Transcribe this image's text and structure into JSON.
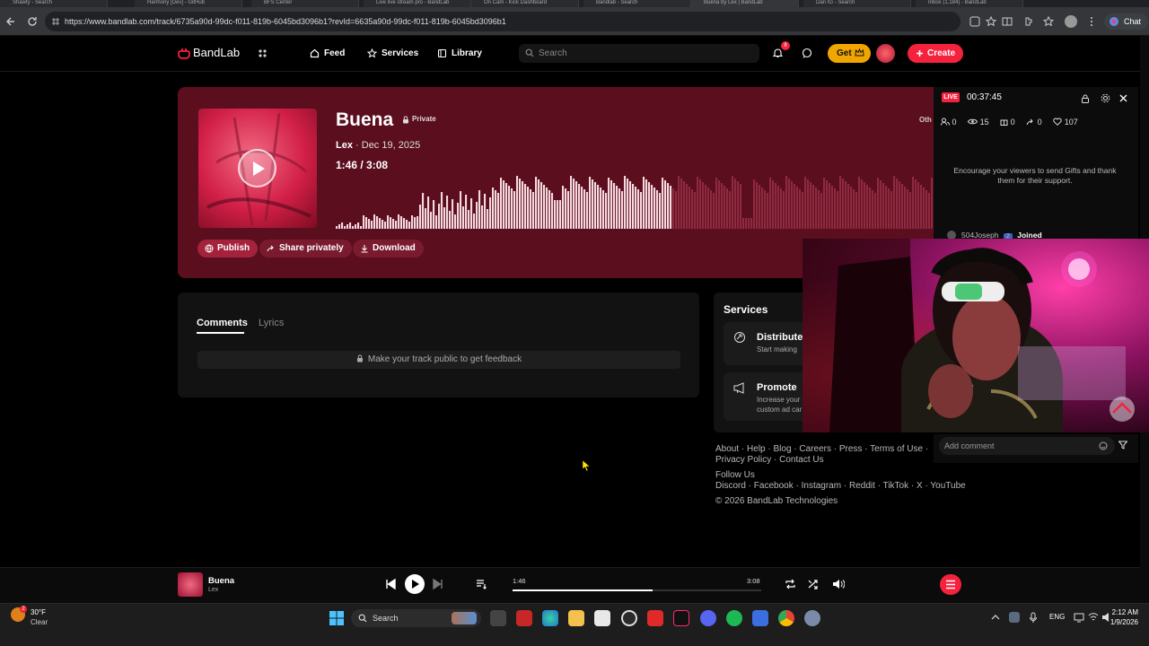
{
  "browser": {
    "tabs": [
      "Shawty - Search",
      "Harmony [Dev] - GitHub",
      "BFS Center",
      "Live live stream pro - BandLab",
      "On Cam - Kick Dashboard",
      "Bandlab - Search",
      "Buena by Lex | BandLab",
      "Dan IG - Search",
      "Inbox (1,184) - BandLab"
    ],
    "url": "https://www.bandlab.com/track/6735a90d-99dc-f011-819b-6045bd3096b1?revId=6635a90d-99dc-f011-819b-6045bd3096b1",
    "chat_label": "Chat"
  },
  "nav": {
    "logo": "BandLab",
    "feed": "Feed",
    "services": "Services",
    "library": "Library",
    "search_placeholder": "Search",
    "notif_count": "8",
    "get_label": "Get",
    "create_label": "Create"
  },
  "track": {
    "title": "Buena",
    "privacy": "Private",
    "artist": "Lex",
    "date": " · Dec 19, 2025",
    "position": "1:46 /",
    "duration": "3:08",
    "progress": 0.564,
    "other_label": "Oth",
    "actions": {
      "publish": "Publish",
      "share": "Share privately",
      "download": "Download"
    }
  },
  "comments": {
    "tab_comments": "Comments",
    "tab_lyrics": "Lyrics",
    "notice": "Make your track public to get feedback"
  },
  "services": {
    "heading": "Services",
    "distribute_title": "Distribute",
    "distribute_desc": "Start making",
    "promote_title": "Promote",
    "promote_desc_1": "Increase your",
    "promote_desc_2": "custom ad car"
  },
  "footer": {
    "row1": [
      "About",
      "Help",
      "Blog",
      "Careers",
      "Press",
      "Terms of Use"
    ],
    "row2": [
      "Privacy Policy",
      "Contact Us"
    ],
    "follow": "Follow Us",
    "socials": [
      "Discord",
      "Facebook",
      "Instagram",
      "Reddit",
      "TikTok",
      "X",
      "YouTube"
    ],
    "copyright": "© 2026 BandLab Technologies"
  },
  "live": {
    "badge": "LIVE",
    "timer": "00:37:45",
    "stats": {
      "users": "0",
      "viewers": "15",
      "gifts": "0",
      "shares": "0",
      "likes": "107"
    },
    "message": "Encourage your viewers to send Gifts and thank them for their support.",
    "joined_user": "504Joseph",
    "joined_level": "2",
    "joined_text": "Joined",
    "comment_placeholder": "Add comment"
  },
  "player": {
    "title": "Buena",
    "artist": "Lex",
    "current": "1:46",
    "total": "3:08",
    "progress": 0.564
  },
  "taskbar": {
    "temp": "30°F",
    "weather": "Clear",
    "weather_badge": "2",
    "search": "Search",
    "lang": "ENG",
    "time": "2:12 AM",
    "date": "1/9/2026"
  },
  "colors": {
    "accent": "#f5223e",
    "hero": "#5b0e1e",
    "gold": "#f0a500"
  }
}
